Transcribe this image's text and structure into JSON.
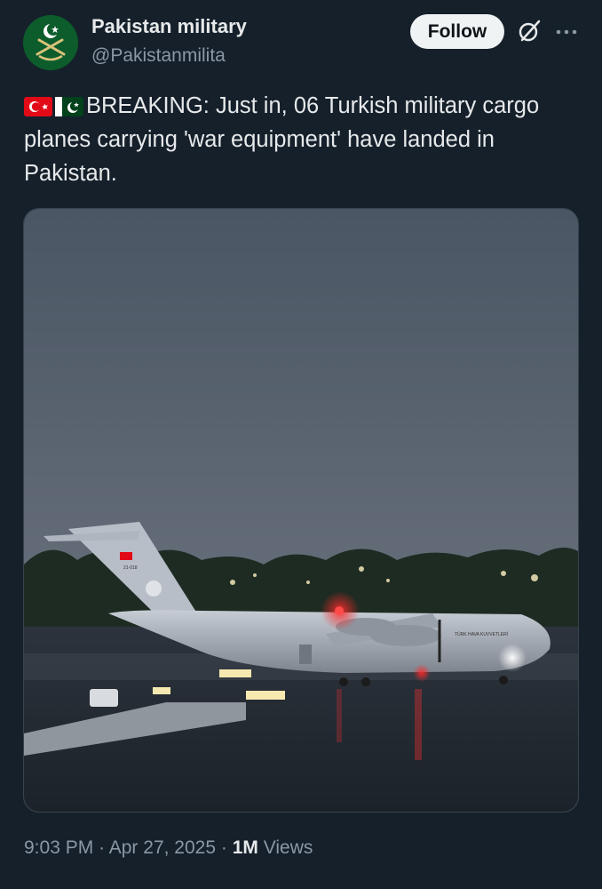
{
  "author": {
    "display_name": "Pakistan military",
    "handle": "@Pakistanmilita",
    "avatar_icon": "pakistan-army-emblem-icon"
  },
  "actions": {
    "follow_label": "Follow",
    "grok_icon": "grok-icon",
    "more_icon": "more-options-icon"
  },
  "tweet": {
    "flags": [
      "turkey-flag-icon",
      "pakistan-flag-icon"
    ],
    "text": "BREAKING: Just in, 06 Turkish military cargo planes carrying 'war equipment' have landed in Pakistan."
  },
  "media": {
    "alt": "Turkish military cargo plane on a runway at night",
    "tail_text": "21-018",
    "fuselage_text": "TÜRK HAVA KUVVETLERİ"
  },
  "metadata": {
    "time": "9:03 PM",
    "separator": "·",
    "date": "Apr 27, 2025",
    "views_count": "1M",
    "views_label": "Views"
  },
  "colors": {
    "background": "#15202b",
    "text_primary": "#e7e9ea",
    "text_secondary": "#8b98a5",
    "follow_bg": "#eff3f4"
  }
}
